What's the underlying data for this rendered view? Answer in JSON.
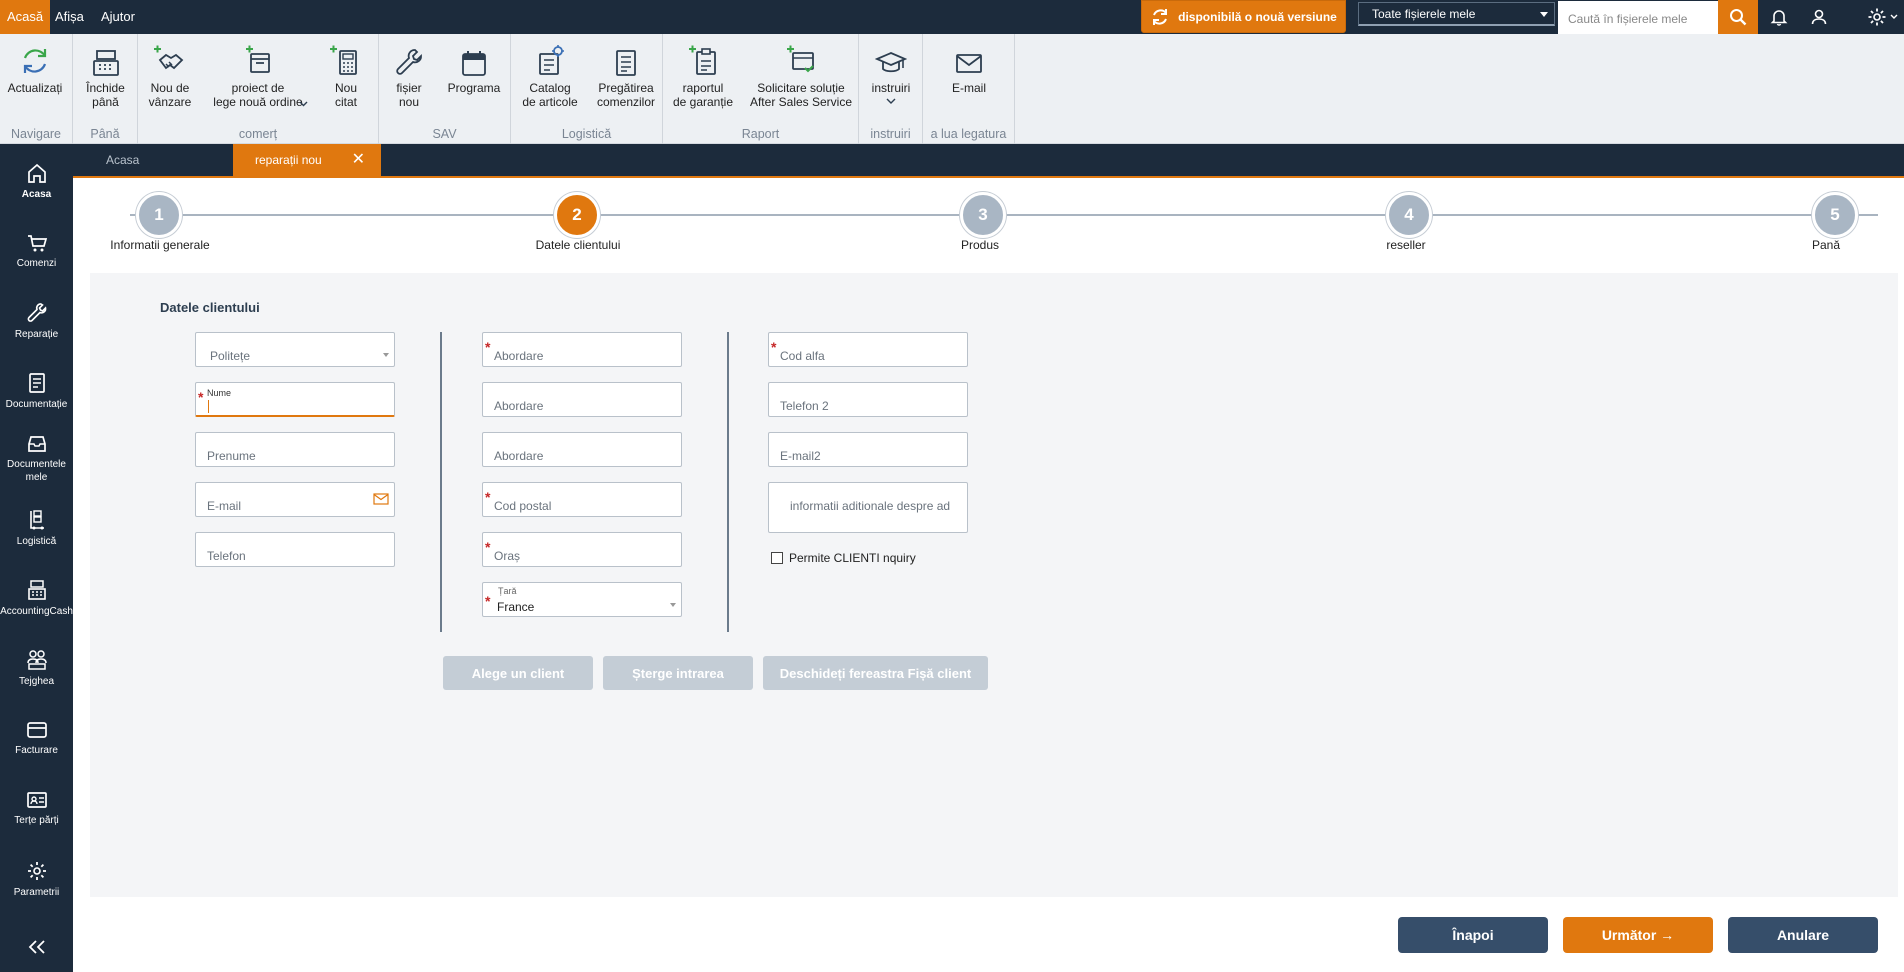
{
  "menu": {
    "items": [
      "Acasă",
      "Afișa",
      "Ajutor"
    ]
  },
  "topbar": {
    "update_label": "disponibilă o nouă versiune",
    "scope_select": "Toate fișierele mele",
    "search_placeholder": "Caută în fișierele mele"
  },
  "ribbon": {
    "groups": [
      {
        "label": "Navigare",
        "buttons": [
          {
            "label": "Actualizați",
            "icon": "refresh-icon"
          }
        ]
      },
      {
        "label": "Până",
        "buttons": [
          {
            "label": "Închide\npână",
            "icon": "cash-register-icon"
          }
        ]
      },
      {
        "label": "comerț",
        "buttons": [
          {
            "label": "Nou de\nvânzare",
            "icon": "handshake-icon"
          },
          {
            "label": "proiect de\nlege nouă ordine",
            "icon": "order-box-icon"
          },
          {
            "label": "Nou\ncitat",
            "icon": "calculator-icon"
          }
        ]
      },
      {
        "label": "SAV",
        "buttons": [
          {
            "label": "fișier\nnou",
            "icon": "wrench-icon"
          },
          {
            "label": "Programa",
            "icon": "calendar-icon"
          }
        ]
      },
      {
        "label": "Logistică",
        "buttons": [
          {
            "label": "Catalog\nde articole",
            "icon": "catalog-icon"
          },
          {
            "label": "Pregătirea\ncomenzilor",
            "icon": "list-icon"
          }
        ]
      },
      {
        "label": "Raport",
        "buttons": [
          {
            "label": "raportul\nde garanție",
            "icon": "clipboard-icon"
          },
          {
            "label": "Solicitare soluție\nAfter Sales Service",
            "icon": "service-request-icon"
          }
        ]
      },
      {
        "label": "instruiri",
        "buttons": [
          {
            "label": "instruiri",
            "icon": "graduation-cap-icon"
          }
        ]
      },
      {
        "label": "a lua legatura",
        "buttons": [
          {
            "label": "E-mail",
            "icon": "envelope-icon"
          }
        ]
      }
    ]
  },
  "sidebar": {
    "items": [
      {
        "label": "Acasa",
        "icon": "home-icon"
      },
      {
        "label": "Comenzi",
        "icon": "cart-icon"
      },
      {
        "label": "Reparație",
        "icon": "wrench-icon"
      },
      {
        "label": "Documentație",
        "icon": "document-icon"
      },
      {
        "label": "Documentele\nmele",
        "icon": "inbox-icon"
      },
      {
        "label": "Logistică",
        "icon": "logistics-icon"
      },
      {
        "label": "AccountingCash",
        "icon": "cash-register-icon"
      },
      {
        "label": "Tejghea",
        "icon": "people-icon"
      },
      {
        "label": "Facturare",
        "icon": "card-icon"
      },
      {
        "label": "Terțe părți",
        "icon": "contact-card-icon"
      },
      {
        "label": "Parametrii",
        "icon": "gear-icon"
      }
    ]
  },
  "tabs": [
    {
      "label": "Acasa"
    },
    {
      "label": "reparații nou"
    }
  ],
  "steps": [
    {
      "number": "1",
      "label": "Informatii generale"
    },
    {
      "number": "2",
      "label": "Datele clientului"
    },
    {
      "number": "3",
      "label": "Produs"
    },
    {
      "number": "4",
      "label": "reseller"
    },
    {
      "number": "5",
      "label": "Pană"
    }
  ],
  "form": {
    "title": "Datele clientului",
    "col1": {
      "politeness": "Politețe",
      "name_label": "Nume",
      "prenume": "Prenume",
      "email": "E-mail",
      "telefon": "Telefon"
    },
    "col2": {
      "abordare1": "Abordare",
      "abordare2": "Abordare",
      "abordare3": "Abordare",
      "cod_postal": "Cod postal",
      "oras": "Oraș",
      "tara_label": "Țară",
      "tara_value": "France"
    },
    "col3": {
      "cod_alfa": "Cod alfa",
      "telefon2": "Telefon 2",
      "email2": "E-mail2",
      "info": "informatii aditionale despre ad",
      "checkbox_label": "Permite CLIENTI nquiry"
    }
  },
  "actions": {
    "choose_client": "Alege un client",
    "clear_entry": "Șterge intrarea",
    "open_client_sheet": "Deschideți fereastra Fișă client"
  },
  "nav": {
    "back": "Înapoi",
    "next": "Următor →",
    "cancel": "Anulare"
  },
  "colors": {
    "accent": "#e0780f",
    "navy": "#1c2b3c",
    "button_dark": "#364e6a"
  }
}
